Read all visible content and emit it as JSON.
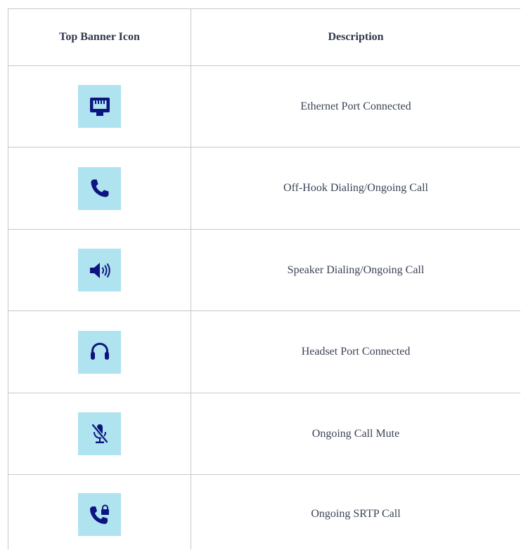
{
  "table": {
    "headers": [
      "Top Banner Icon",
      "Description"
    ],
    "rows": [
      {
        "icon": "ethernet-port-icon",
        "description": "Ethernet Port Connected"
      },
      {
        "icon": "phone-handset-icon",
        "description": "Off-Hook Dialing/Ongoing Call"
      },
      {
        "icon": "speaker-volume-icon",
        "description": "Speaker Dialing/Ongoing Call"
      },
      {
        "icon": "headset-icon",
        "description": "Headset Port Connected"
      },
      {
        "icon": "microphone-muted-icon",
        "description": "Ongoing Call Mute"
      },
      {
        "icon": "phone-lock-icon",
        "description": "Ongoing SRTP Call"
      }
    ]
  },
  "colors": {
    "icon_background": "#aee3ef",
    "icon_foreground": "#0d1480",
    "border": "#c8c8c8",
    "text": "#3b4356"
  }
}
